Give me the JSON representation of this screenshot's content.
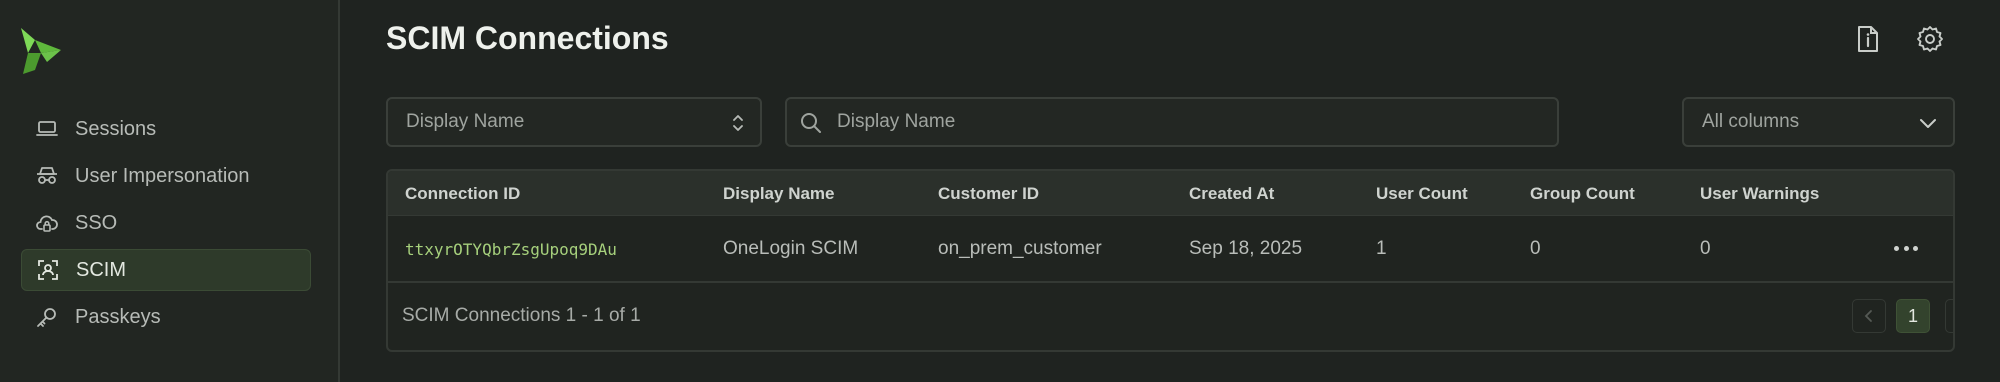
{
  "colors": {
    "accent": "#6cc24a",
    "background": "#1f2320",
    "active_nav": "#2e3a2a",
    "id_text": "#a6d07c"
  },
  "sidebar": {
    "logo_icon": "brand-logo",
    "items": [
      {
        "label": "Sessions",
        "icon": "laptop-icon",
        "active": false
      },
      {
        "label": "User Impersonation",
        "icon": "incognito-icon",
        "active": false
      },
      {
        "label": "SSO",
        "icon": "cloud-lock-icon",
        "active": false
      },
      {
        "label": "SCIM",
        "icon": "user-scan-icon",
        "active": true
      },
      {
        "label": "Passkeys",
        "icon": "key-icon",
        "active": false
      }
    ]
  },
  "header": {
    "title": "SCIM Connections",
    "icons": [
      "doc-info-icon",
      "gear-icon"
    ]
  },
  "filters": {
    "field_select": "Display Name",
    "search_placeholder": "Display Name",
    "columns_select": "All columns"
  },
  "table": {
    "columns": [
      "Connection ID",
      "Display Name",
      "Customer ID",
      "Created At",
      "User Count",
      "Group Count",
      "User Warnings"
    ],
    "rows": [
      [
        "ttxyrOTYQbrZsgUpoq9DAu",
        "OneLogin SCIM",
        "on_prem_customer",
        "Sep 18, 2025",
        "1",
        "0",
        "0"
      ]
    ]
  },
  "footer": {
    "summary": "SCIM Connections 1 - 1 of 1",
    "current_page": "1",
    "prev": "‹",
    "next": "›"
  }
}
